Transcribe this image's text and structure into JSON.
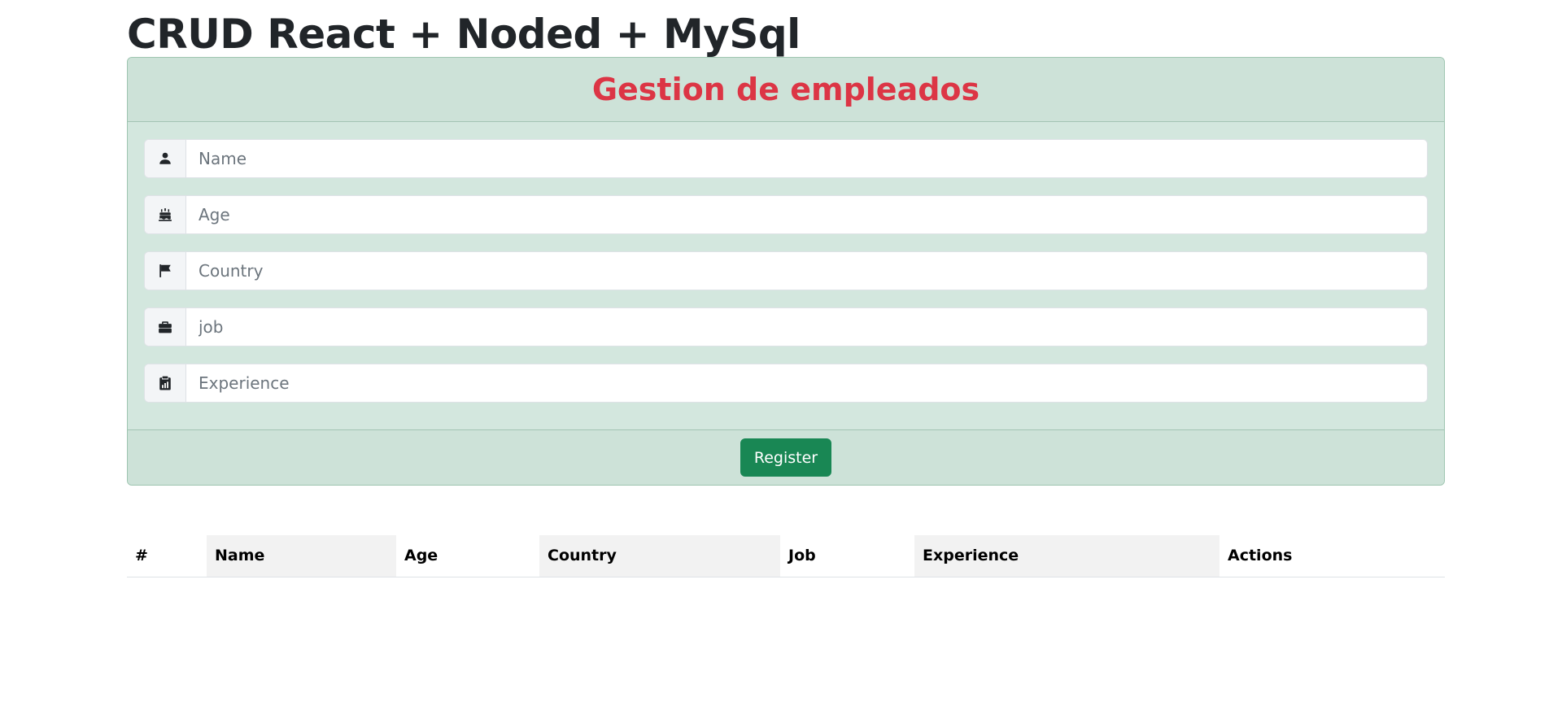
{
  "app": {
    "title": "CRUD React + Noded + MySql"
  },
  "card": {
    "header_title": "Gestion de empleados",
    "fields": [
      {
        "icon": "person-icon",
        "placeholder": "Name",
        "value": ""
      },
      {
        "icon": "cake-icon",
        "placeholder": "Age",
        "value": ""
      },
      {
        "icon": "flag-icon",
        "placeholder": "Country",
        "value": ""
      },
      {
        "icon": "briefcase-icon",
        "placeholder": "job",
        "value": ""
      },
      {
        "icon": "clipboard-data-icon",
        "placeholder": "Experience",
        "value": ""
      }
    ],
    "register_label": "Register"
  },
  "table": {
    "headers": [
      "#",
      "Name",
      "Age",
      "Country",
      "Job",
      "Experience",
      "Actions"
    ],
    "rows": []
  },
  "colors": {
    "card_background": "#d3e7de",
    "header_title": "#dc3545",
    "register_button": "#198754"
  }
}
